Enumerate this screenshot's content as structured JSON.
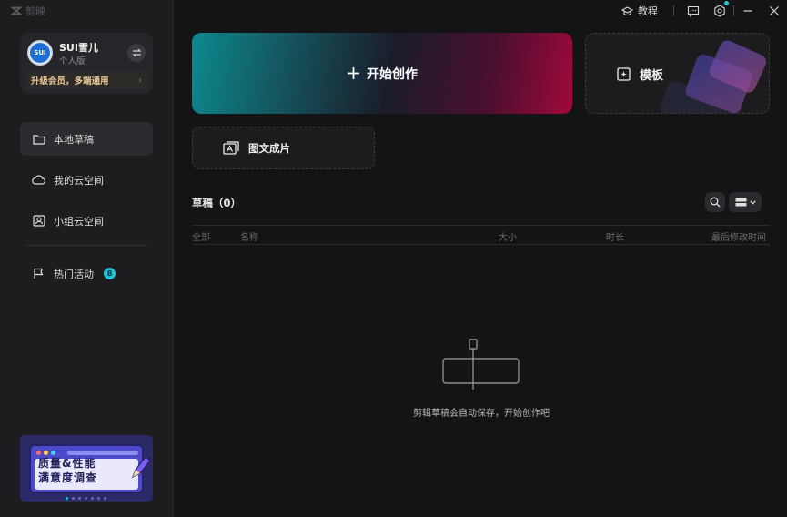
{
  "app": {
    "name": "剪映"
  },
  "user": {
    "avatar_text": "SUI",
    "name": "SUI雪儿",
    "plan": "个人版",
    "upgrade_text": "升级会员，多端通用",
    "upgrade_arrow": "›"
  },
  "sidebar": {
    "items": [
      {
        "label": "本地草稿",
        "icon": "folder-icon",
        "active": true
      },
      {
        "label": "我的云空间",
        "icon": "cloud-icon",
        "active": false
      },
      {
        "label": "小组云空间",
        "icon": "team-icon",
        "active": false
      },
      {
        "label": "热门活动",
        "icon": "flag-icon",
        "active": false,
        "badge": "8"
      }
    ],
    "banner": {
      "line1": "质量&性能",
      "line2": "满意度调查"
    }
  },
  "topbar": {
    "tutorial_label": "教程"
  },
  "main": {
    "create_label": "开始创作",
    "template_label": "模板",
    "image_text_label": "图文成片",
    "drafts_title": "草稿（0）",
    "table_headers": {
      "all": "全部",
      "name": "名称",
      "size": "大小",
      "duration": "时长",
      "modified": "最后修改时间"
    },
    "empty_text": "剪辑草稿会自动保存，开始创作吧"
  },
  "colors": {
    "accent": "#22c2d6",
    "create_gradient_start": "#0b8a8e",
    "create_gradient_end": "#a0083c",
    "upgrade_gold": "#e8c89a"
  }
}
